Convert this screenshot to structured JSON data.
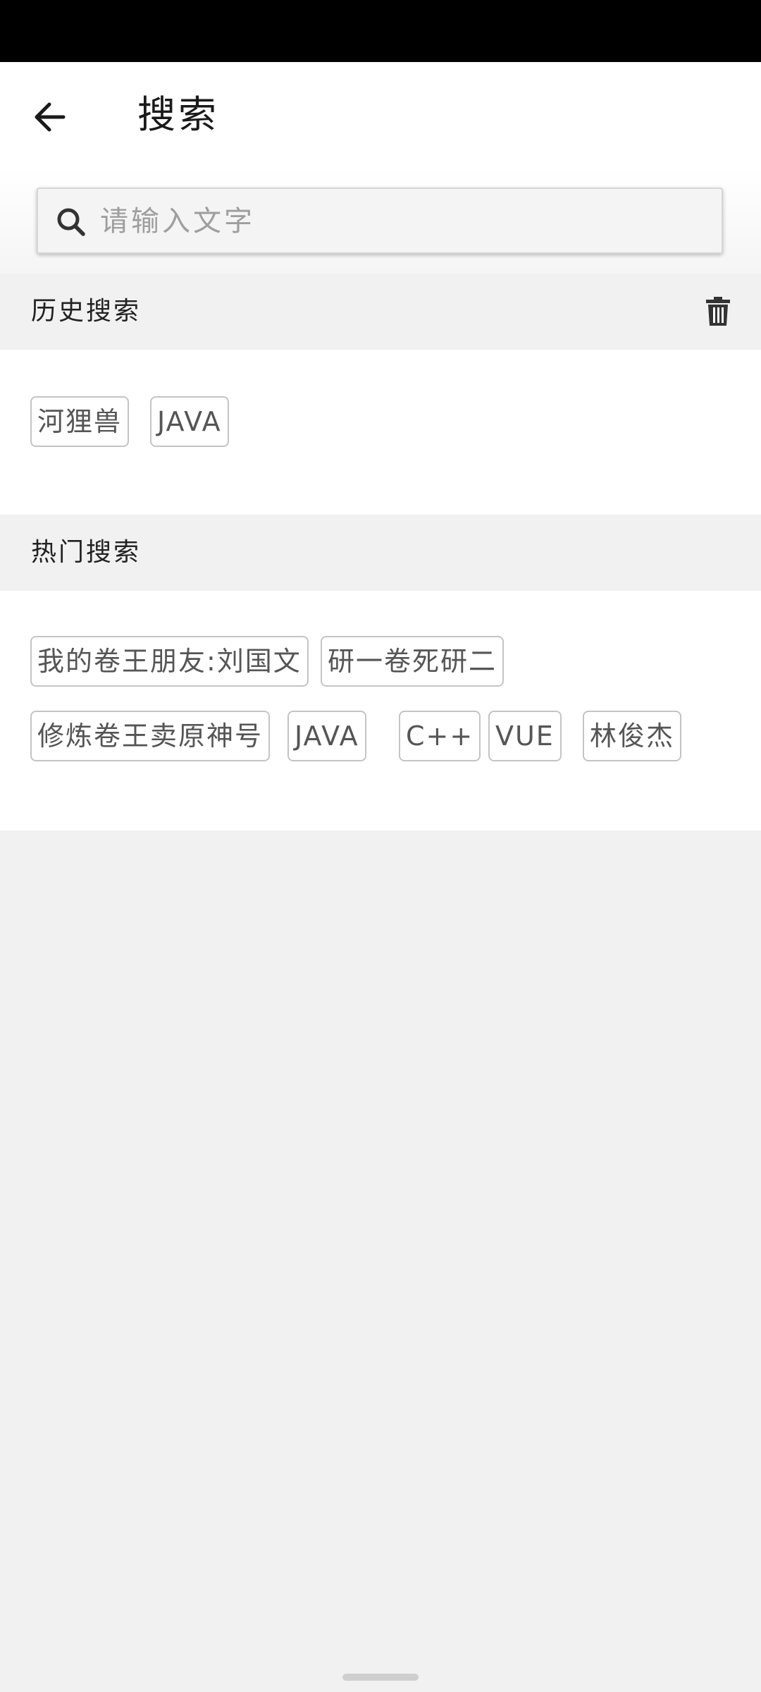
{
  "header": {
    "title": "搜索",
    "back_icon": "arrow-left-icon"
  },
  "search": {
    "placeholder": "请输入文字",
    "value": "",
    "icon": "search-icon"
  },
  "history": {
    "title": "历史搜索",
    "clear_icon": "trash-icon",
    "tags": [
      "河狸兽",
      "JAVA"
    ]
  },
  "hot": {
    "title": "热门搜索",
    "tags": [
      "我的卷王朋友:刘国文",
      "研一卷死研二",
      "修炼卷王卖原神号",
      "JAVA",
      "C++",
      "VUE",
      "林俊杰"
    ]
  },
  "colors": {
    "status_bar": "#000000",
    "header_bg": "#ffffff",
    "page_bg": "#f1f1f1",
    "tag_border": "#c4c4c4",
    "tag_text": "#555555",
    "placeholder": "#9e9e9e"
  }
}
